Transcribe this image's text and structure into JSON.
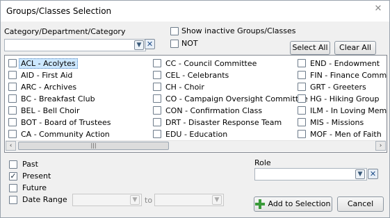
{
  "window": {
    "title": "Groups/Classes Selection",
    "close_symbol": "✕"
  },
  "category": {
    "label": "Category/Department/Category",
    "value": ""
  },
  "options": {
    "show_inactive": "Show inactive Groups/Classes",
    "not": "NOT"
  },
  "buttons": {
    "select_all": "Select All",
    "clear_all": "Clear All",
    "add": "Add to Selection",
    "cancel": "Cancel"
  },
  "groups": {
    "col1": [
      "ACL - Acolytes",
      "AID - First Aid",
      "ARC - Archives",
      "BC - Breakfast Club",
      "BEL - Bell Choir",
      "BOT - Board of Trustees",
      "CA - Community Action"
    ],
    "col2": [
      "CC - Council Committee",
      "CEL - Celebrants",
      "CH - Choir",
      "CO - Campaign Oversight Committee",
      "CON - Confirmation Class",
      "DRT - Disaster Response Team",
      "EDU - Education"
    ],
    "col3": [
      "END - Endowment",
      "FIN - Finance Committee",
      "GRT - Greeters",
      "HG - Hiking Group",
      "ILM - In Loving Memory",
      "MIS - Missions",
      "MOF - Men of Faith"
    ],
    "selected": "ACL - Acolytes"
  },
  "timeframe": {
    "past": "Past",
    "present": "Present",
    "present_checked": true,
    "future": "Future",
    "date_range": "Date Range",
    "to": "to"
  },
  "role": {
    "label": "Role",
    "value": ""
  },
  "icons": {
    "dropdown": "chevron-down-icon",
    "clear": "clear-x-icon",
    "add": "plus-icon",
    "scroll_left": "‹",
    "scroll_right": "›",
    "grip": "|||"
  }
}
